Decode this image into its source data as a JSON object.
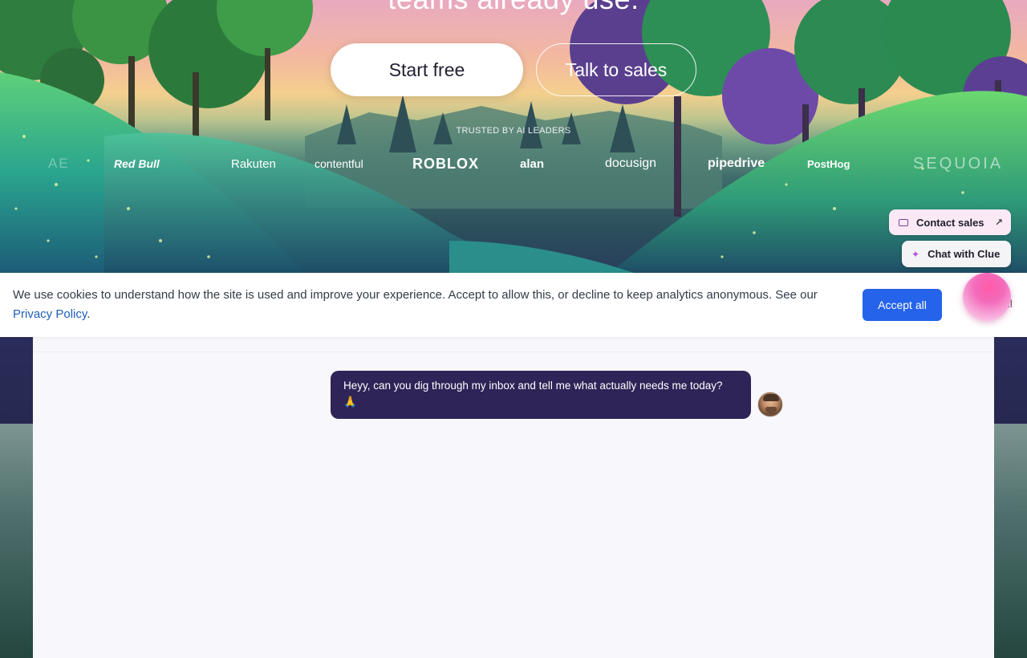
{
  "hero": {
    "headline_partial": "teams already use.",
    "start_button": "Start free",
    "sales_button": "Talk to sales",
    "trusted_label": "TRUSTED BY AI LEADERS",
    "logos": [
      "AE",
      "Red Bull",
      "Rakuten",
      "contentful",
      "ROBLOX",
      "alan",
      "docusign",
      "pipedrive",
      "PostHog",
      "SEQUOIA"
    ]
  },
  "widgets": {
    "contact_sales": "Contact sales",
    "chat_with": "Chat with Clue"
  },
  "cookie": {
    "text": "We use cookies to understand how the site is used and improve your experience. Accept to allow this, or decline to keep analytics anonymous. See our ",
    "link": "Privacy Policy",
    "after_link": ".",
    "accept": "Accept all",
    "decline_partial": "ll"
  },
  "chat": {
    "message": "Heyy, can you dig through my inbox and tell me what actually needs me today? 🙏"
  },
  "colors": {
    "accept_button": "#2563eb",
    "bubble": "#2e2457",
    "link": "#1d5fb8",
    "contact_pill": "#fbe9f6",
    "orb": "#f36bbb"
  }
}
